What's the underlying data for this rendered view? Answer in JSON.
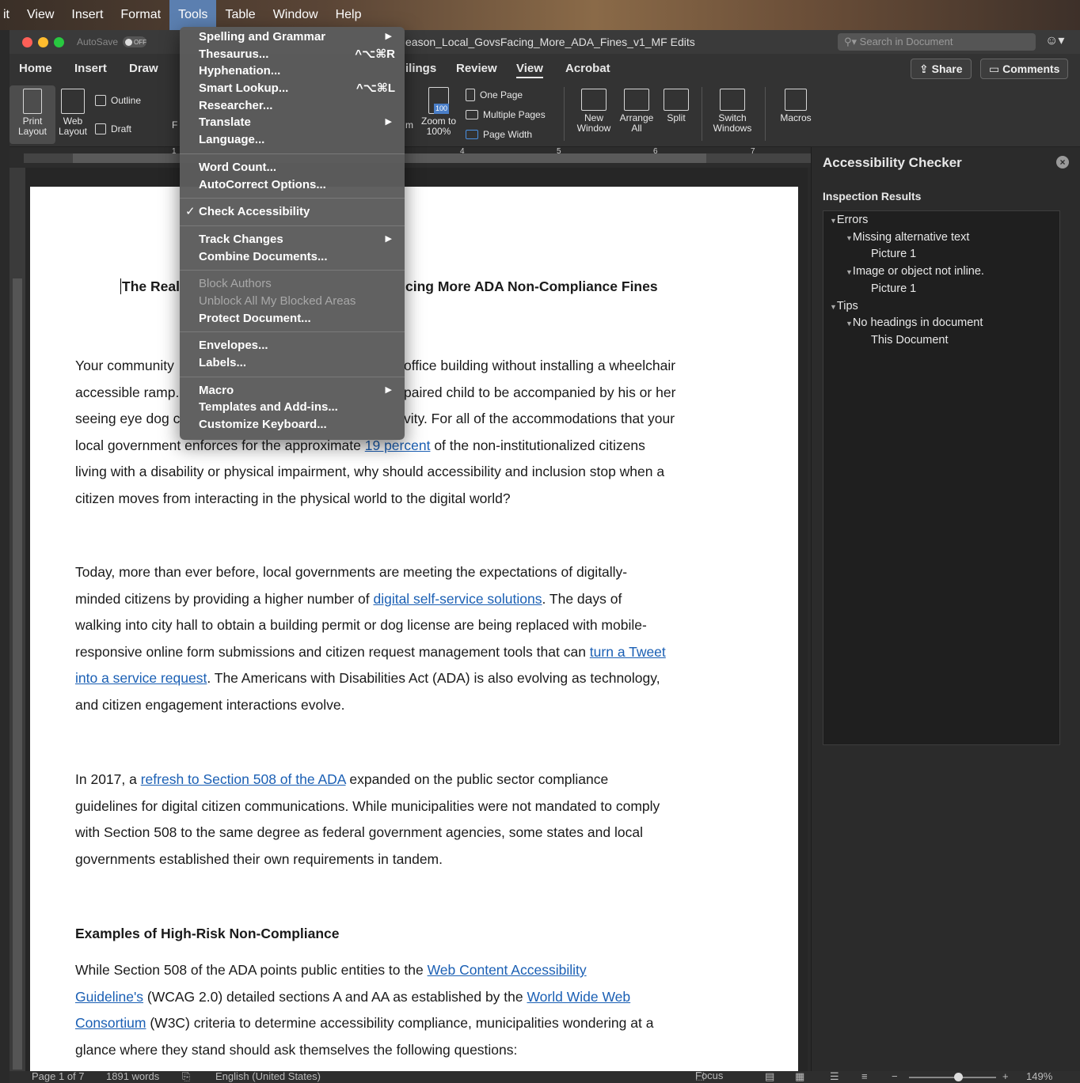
{
  "menubar": {
    "items": [
      "it",
      "View",
      "Insert",
      "Format",
      "Tools",
      "Table",
      "Window",
      "Help"
    ],
    "active": "Tools"
  },
  "titlebar": {
    "autosave": "AutoSave",
    "autosave_state": "OFF",
    "document_title": "eason_Local_GovsFacing_More_ADA_Fines_v1_MF Edits",
    "search_placeholder": "Search in Document"
  },
  "ribbon_tabs": {
    "home": "Home",
    "insert": "Insert",
    "draw": "Draw",
    "mailings": "ilings",
    "review": "Review",
    "view": "View",
    "acrobat": "Acrobat",
    "share": "Share",
    "comments": "Comments"
  },
  "ribbon": {
    "print_layout": "Print Layout",
    "web_layout": "Web Layout",
    "outline": "Outline",
    "draft": "Draft",
    "focus_cut": "F",
    "zoom_cut": "m",
    "zoom_100": "Zoom to 100%",
    "zoom_icon_text": "100",
    "one_page": "One Page",
    "multiple_pages": "Multiple Pages",
    "page_width": "Page Width",
    "new_window": "New Window",
    "arrange_all": "Arrange All",
    "split": "Split",
    "switch_windows": "Switch Windows",
    "macros": "Macros"
  },
  "ruler": {
    "numbers": [
      "1",
      "4",
      "5",
      "6",
      "7"
    ]
  },
  "tools_menu": {
    "items": [
      {
        "label": "Spelling and Grammar",
        "submenu": true
      },
      {
        "label": "Thesaurus...",
        "shortcut": "^⌥⌘R"
      },
      {
        "label": "Hyphenation..."
      },
      {
        "label": "Smart Lookup...",
        "shortcut": "^⌥⌘L"
      },
      {
        "label": "Researcher..."
      },
      {
        "label": "Translate",
        "submenu": true
      },
      {
        "label": "Language..."
      },
      {
        "sep": true
      },
      {
        "label": "Word Count..."
      },
      {
        "label": "AutoCorrect Options..."
      },
      {
        "sep": true
      },
      {
        "label": "Check Accessibility",
        "checked": true
      },
      {
        "sep": true
      },
      {
        "label": "Track Changes",
        "submenu": true
      },
      {
        "label": "Combine Documents..."
      },
      {
        "sep": true
      },
      {
        "label": "Block Authors",
        "disabled": true
      },
      {
        "label": "Unblock All My Blocked Areas",
        "disabled": true
      },
      {
        "label": "Protect Document..."
      },
      {
        "sep": true
      },
      {
        "label": "Envelopes..."
      },
      {
        "label": "Labels..."
      },
      {
        "sep": true
      },
      {
        "label": "Macro",
        "submenu": true
      },
      {
        "label": "Templates and Add-ins..."
      },
      {
        "label": "Customize Keyboard..."
      }
    ]
  },
  "document": {
    "title_left": "The Real",
    "title_right": "cing More ADA Non-Compliance Fines",
    "p1": {
      "l1a": "Your community",
      "l1b": "office building without installing a wheelchair",
      "l2a": "accessible ramp.",
      "l2b": "paired child to be accompanied by his or her",
      "l3a": "seeing eye dog c",
      "l3b": "vity. For all of the accommodations that your",
      "l4a": "local government enforces for the approximate ",
      "l4link": "19 percent",
      "l4b": " of the non-institutionalized citizens",
      "l5": "living with a disability or physical impairment, why should accessibility and inclusion stop when a",
      "l6": "citizen moves from interacting in the physical world to the digital world?"
    },
    "p2": {
      "l1": "Today, more than ever before, local governments are meeting the expectations of digitally-",
      "l2a": "minded citizens by providing a higher number of ",
      "l2link": "digital self-service solutions",
      "l2b": ". The days of",
      "l3": "walking into city hall to obtain a building permit or dog license are being replaced with mobile-",
      "l4a": "responsive online form submissions and citizen request management tools that can ",
      "l4link": "turn a Tweet",
      "l5link": "into a service request",
      "l5b": ". The Americans with Disabilities Act (ADA) is also evolving as technology,",
      "l6": "and citizen engagement interactions evolve."
    },
    "p3": {
      "l1a": "In 2017, a ",
      "l1link": "refresh to Section 508 of the ADA",
      "l1b": " expanded on the public sector compliance",
      "l2": "guidelines for digital citizen communications. While municipalities were not mandated to comply",
      "l3": "with Section 508 to the same degree as federal government agencies, some states and local",
      "l4": "governments established their own requirements in tandem."
    },
    "subheading": "Examples of High-Risk Non-Compliance",
    "p4": {
      "l1a": "While Section 508 of the ADA points public entities to the ",
      "l1link": "Web Content Accessibility",
      "l2link": "Guideline's",
      "l2b": " (WCAG 2.0) detailed sections A and AA as established by the ",
      "l2link2": "World Wide Web",
      "l3link": "Consortium",
      "l3b": " (W3C) criteria to determine accessibility compliance, municipalities wondering at a",
      "l4": "glance where they stand should ask themselves the following questions:"
    }
  },
  "accessibility": {
    "title": "Accessibility Checker",
    "inspection": "Inspection Results",
    "tree": [
      {
        "label": "Errors",
        "level": 0,
        "arrow": true
      },
      {
        "label": "Missing alternative text",
        "level": 1,
        "arrow": true
      },
      {
        "label": "Picture 1",
        "level": 2
      },
      {
        "label": "Image or object not inline.",
        "level": 1,
        "arrow": true
      },
      {
        "label": "Picture 1",
        "level": 2
      },
      {
        "label": "Tips",
        "level": 0,
        "arrow": true
      },
      {
        "label": "No headings in document",
        "level": 1,
        "arrow": true
      },
      {
        "label": "This Document",
        "level": 2
      }
    ]
  },
  "statusbar": {
    "page": "Page 1 of 7",
    "words": "1891 words",
    "language": "English (United States)",
    "focus": "Focus",
    "zoom": "149%",
    "zoom_fraction": 0.56
  }
}
